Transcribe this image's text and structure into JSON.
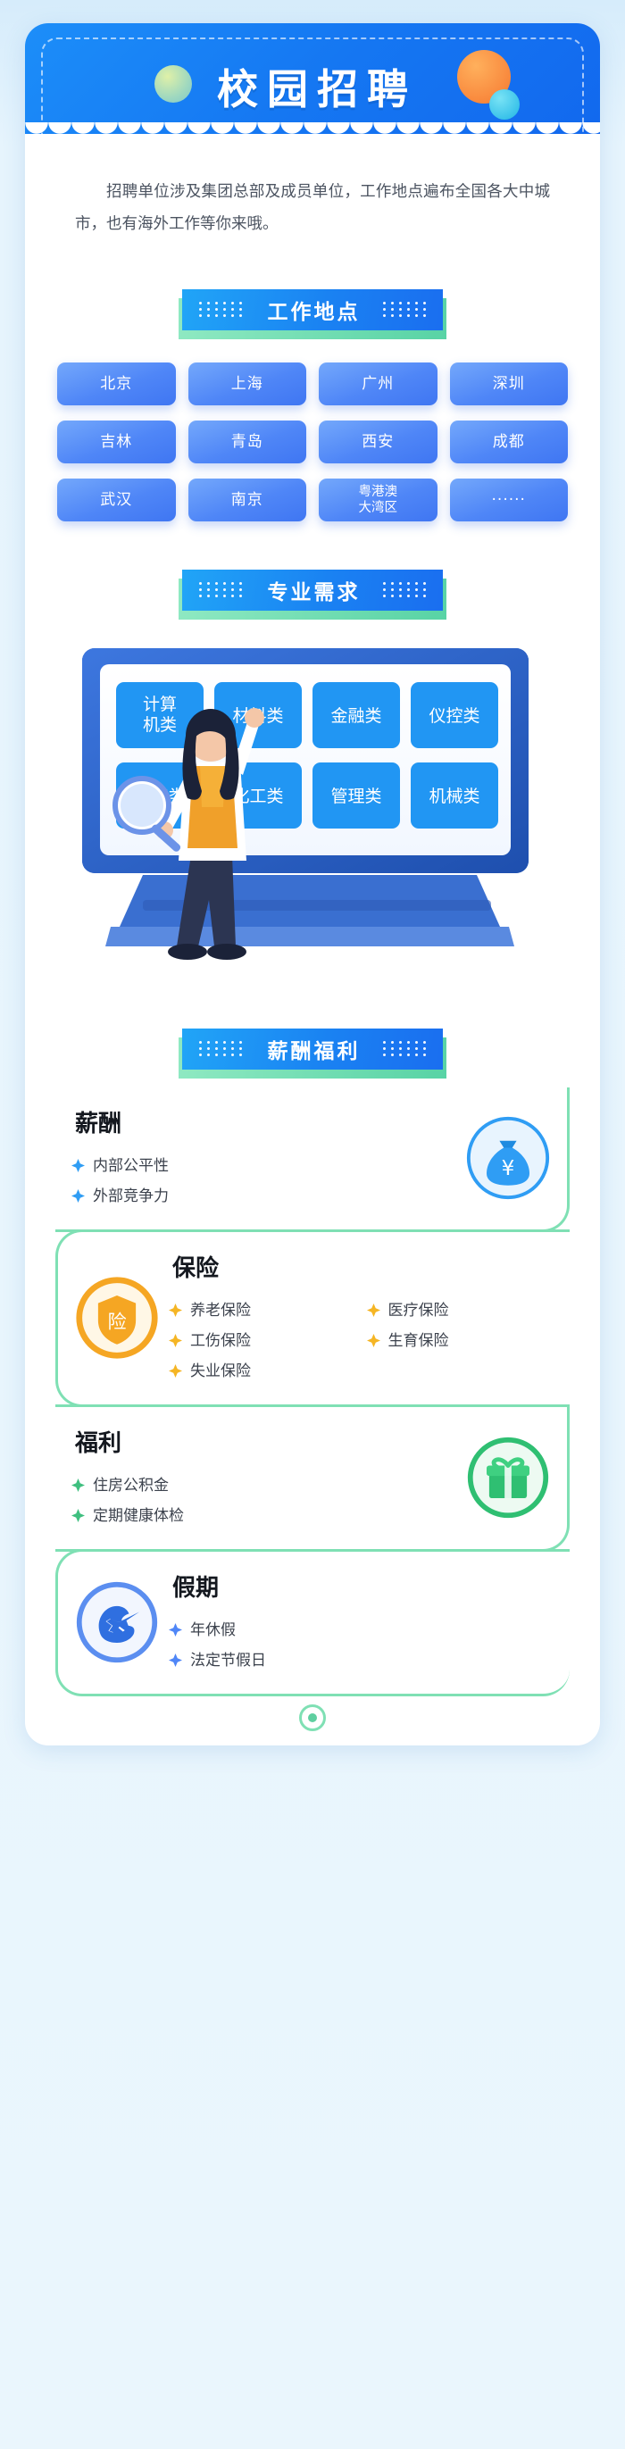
{
  "header": {
    "title": "校园招聘",
    "bubbles": [
      "green-bubble",
      "orange-bubble",
      "cyan-bubble"
    ]
  },
  "intro": {
    "paragraph": "招聘单位涉及集团总部及成员单位，工作地点遍布全国各大中城市，也有海外工作等你来哦。"
  },
  "sections": {
    "location_banner": "工作地点",
    "major_banner": "专业需求",
    "benefit_banner": "薪酬福利"
  },
  "locations": [
    "北京",
    "上海",
    "广州",
    "深圳",
    "吉林",
    "青岛",
    "西安",
    "成都",
    "武汉",
    "南京",
    "粤港澳\n大湾区",
    "······"
  ],
  "majors": [
    "计算\n机类",
    "材料类",
    "金融类",
    "仪控类",
    "电气类",
    "化工类",
    "管理类",
    "机械类"
  ],
  "benefits": [
    {
      "title": "薪酬",
      "highlight": "#a9d8f5",
      "icon": "money-bag-icon",
      "icon_side": "right",
      "accent": "#2f9df4",
      "columns": 1,
      "items": [
        "内部公平性",
        "外部竞争力"
      ]
    },
    {
      "title": "保险",
      "highlight": "#fbe3a6",
      "icon": "insurance-shield-icon",
      "icon_side": "left",
      "accent": "#f5b524",
      "columns": 2,
      "items": [
        "养老保险",
        "医疗保险",
        "工伤保险",
        "生育保险",
        "失业保险"
      ]
    },
    {
      "title": "福利",
      "highlight": "#bdeccf",
      "icon": "gift-box-icon",
      "icon_side": "right",
      "accent": "#3fbf7f",
      "columns": 1,
      "items": [
        "住房公积金",
        "定期健康体检"
      ]
    },
    {
      "title": "假期",
      "highlight": "#cfdcf3",
      "icon": "travel-plane-icon",
      "icon_side": "left",
      "accent": "#4f86f7",
      "columns": 1,
      "items": [
        "年休假",
        "法定节假日"
      ]
    }
  ],
  "colors": {
    "page_bg": "#e6f4fd",
    "header_blue": "#1577f2",
    "tag_blue": "#4f86f7",
    "rail_green": "#7fe0b4",
    "banner_green": "#58d3a5"
  }
}
